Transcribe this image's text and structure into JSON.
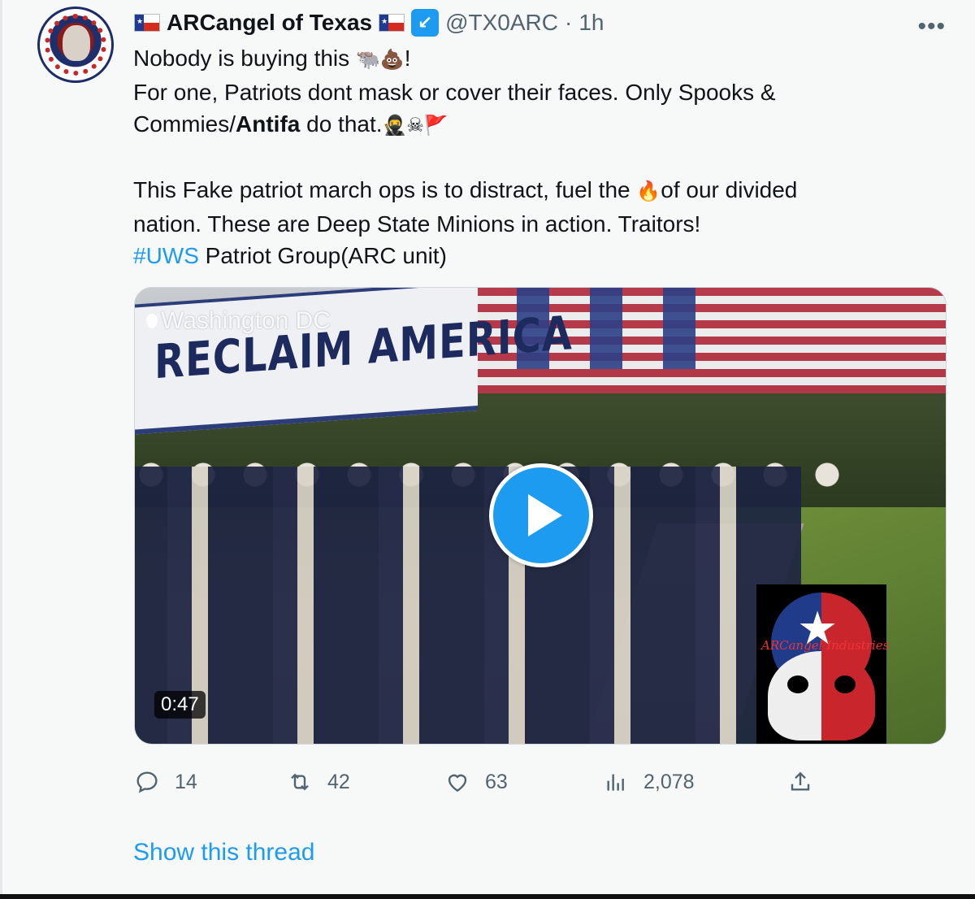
{
  "tweet": {
    "display_name": "ARCangel of Texas",
    "badge_icon": "verified-badge-icon",
    "handle": "@TX0ARC",
    "separator": "·",
    "time": "1h",
    "more_label": "•••",
    "text": {
      "line1_a": "Nobody is buying this ",
      "line1_emoji": "🐃💩",
      "line1_b": "!",
      "line2": "For one, Patriots dont mask or cover their faces. Only Spooks &",
      "line3_a": "Commies/",
      "line3_bold": "Antifa",
      "line3_b": " do that.",
      "line3_emoji": "🥷☠🚩",
      "line4_a": "This Fake patriot march ops is to distract, fuel the ",
      "line4_emoji": "🔥",
      "line4_b": "of our divided",
      "line5": "nation. These are Deep State Minions in action. Traitors!",
      "line6_hashtag": "#UWS",
      "line6_rest": " Patriot Group(ARC unit)"
    },
    "media": {
      "banner_text": "RECLAIM AMERICA",
      "location": "Washington DC",
      "duration": "0:47",
      "overlay_logo_text": "ARCangel Industries"
    },
    "actions": {
      "replies": "14",
      "retweets": "42",
      "likes": "63",
      "views": "2,078"
    },
    "show_thread": "Show this thread"
  },
  "colors": {
    "accent": "#1d9bf0",
    "secondary_text": "#536471",
    "primary_text": "#0f1419"
  }
}
